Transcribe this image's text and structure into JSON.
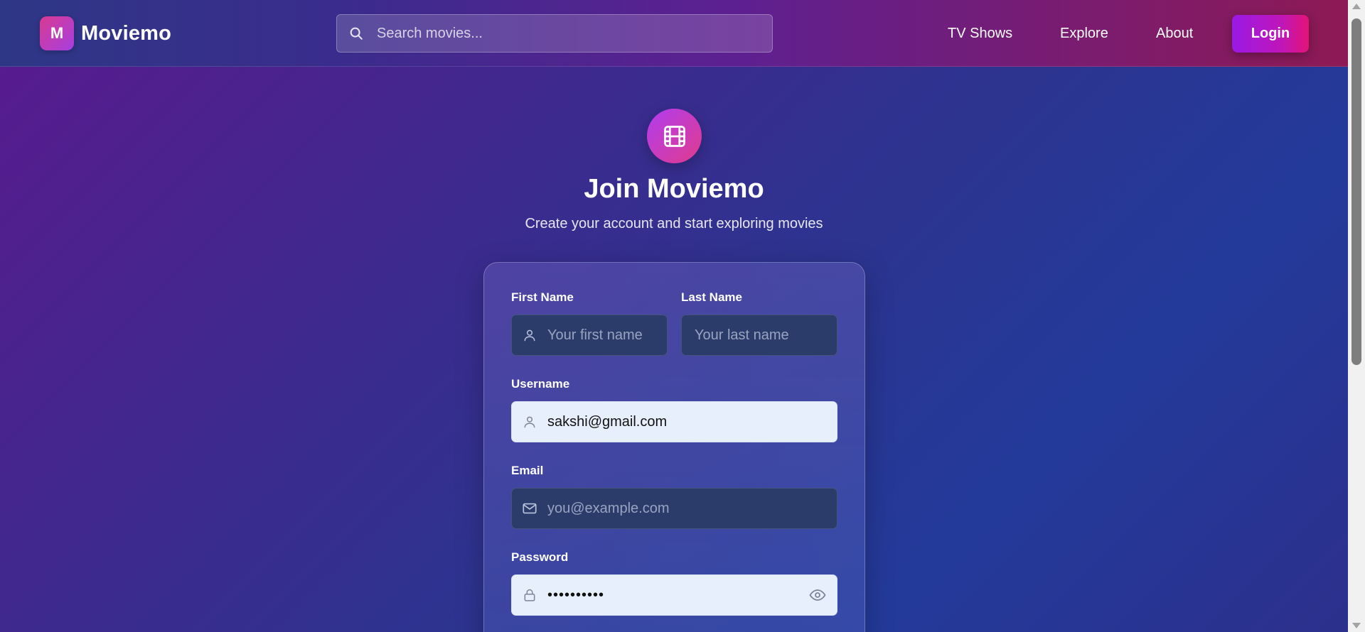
{
  "header": {
    "logo_letter": "M",
    "brand": "Moviemo",
    "search_placeholder": "Search movies...",
    "nav": {
      "tv_shows": "TV Shows",
      "explore": "Explore",
      "about": "About"
    },
    "login_label": "Login"
  },
  "hero": {
    "icon": "film-icon",
    "title": "Join Moviemo",
    "subtitle": "Create your account and start exploring movies"
  },
  "form": {
    "first_name": {
      "label": "First Name",
      "placeholder": "Your first name",
      "value": "",
      "icon": "user-icon"
    },
    "last_name": {
      "label": "Last Name",
      "placeholder": "Your last name",
      "value": ""
    },
    "username": {
      "label": "Username",
      "placeholder": "",
      "value": "sakshi@gmail.com",
      "icon": "user-icon"
    },
    "email": {
      "label": "Email",
      "placeholder": "you@example.com",
      "value": "",
      "icon": "mail-icon"
    },
    "password": {
      "label": "Password",
      "value": "••••••••••",
      "icon": "lock-icon",
      "toggle_icon": "eye-icon"
    }
  },
  "colors": {
    "accent_start": "#9a19e6",
    "accent_end": "#e31377",
    "field_dark": "#2b3c6b",
    "field_light": "#e8effc"
  }
}
